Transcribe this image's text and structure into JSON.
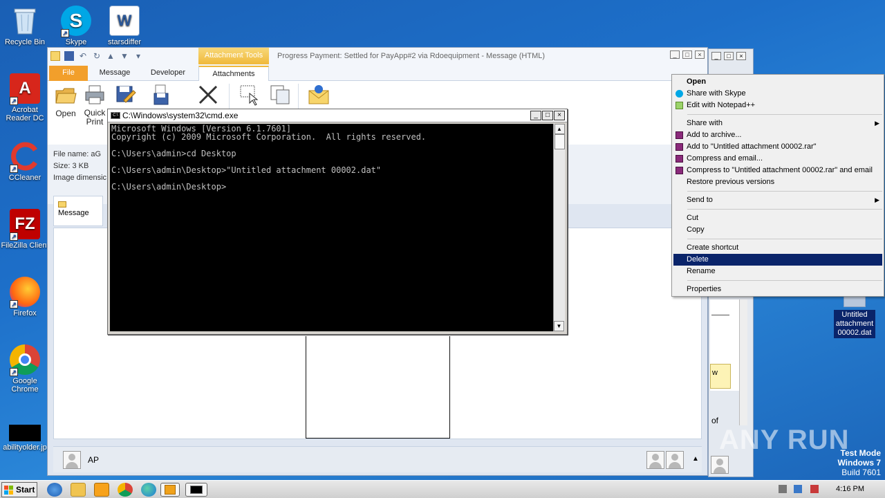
{
  "desktop": {
    "icons": [
      {
        "label": "Recycle Bin"
      },
      {
        "label": "Skype"
      },
      {
        "label": "starsdiffer"
      },
      {
        "label": "Acrobat Reader DC"
      },
      {
        "label": "CCleaner"
      },
      {
        "label": "FileZilla Client"
      },
      {
        "label": "Firefox"
      },
      {
        "label": "Google Chrome"
      },
      {
        "label": "abilityolder.jp"
      }
    ],
    "selected_file": {
      "label": "Untitled attachment 00002.dat"
    }
  },
  "outlook": {
    "context_tab": "Attachment Tools",
    "caption": "Progress Payment: Settled for PayApp#2 via Rdoequipment  -  Message (HTML)",
    "tabs": [
      "File",
      "Message",
      "Developer",
      "Attachments"
    ],
    "ribbon": {
      "open": "Open",
      "quick_print": "Quick Print"
    },
    "info": {
      "file_name": "File name:  aG",
      "size": "Size:  3 KB",
      "image_dims": "Image dimensic"
    },
    "message_tab": "Message",
    "people": {
      "name": "AP"
    }
  },
  "cmd": {
    "title": "C:\\Windows\\system32\\cmd.exe",
    "lines": [
      "Microsoft Windows [Version 6.1.7601]",
      "Copyright (c) 2009 Microsoft Corporation.  All rights reserved.",
      "",
      "C:\\Users\\admin>cd Desktop",
      "",
      "C:\\Users\\admin\\Desktop>\"Untitled attachment 00002.dat\"",
      "",
      "C:\\Users\\admin\\Desktop>"
    ]
  },
  "context_menu": {
    "items": [
      {
        "label": "Open",
        "bold": true
      },
      {
        "label": "Share with Skype",
        "icon": "skype-icon"
      },
      {
        "label": "Edit with Notepad++",
        "icon": "notepadpp-icon"
      },
      {
        "sep": true
      },
      {
        "label": "Share with",
        "submenu": true
      },
      {
        "label": "Add to archive...",
        "icon": "winrar-icon"
      },
      {
        "label": "Add to \"Untitled attachment 00002.rar\"",
        "icon": "winrar-icon"
      },
      {
        "label": "Compress and email...",
        "icon": "winrar-icon"
      },
      {
        "label": "Compress to \"Untitled attachment 00002.rar\" and email",
        "icon": "winrar-icon"
      },
      {
        "label": "Restore previous versions"
      },
      {
        "sep": true
      },
      {
        "label": "Send to",
        "submenu": true
      },
      {
        "sep": true
      },
      {
        "label": "Cut"
      },
      {
        "label": "Copy"
      },
      {
        "sep": true
      },
      {
        "label": "Create shortcut"
      },
      {
        "label": "Delete",
        "selected": true
      },
      {
        "label": "Rename"
      },
      {
        "sep": true
      },
      {
        "label": "Properties"
      }
    ]
  },
  "watermark": {
    "text": "ANY RUN"
  },
  "test_mode": {
    "line1": "Test Mode",
    "line2": "Windows 7",
    "line3": "Build 7601"
  },
  "taskbar": {
    "start": "Start",
    "clock": "4:16 PM"
  },
  "win2": {
    "of_text": "of",
    "w_text": "w"
  }
}
